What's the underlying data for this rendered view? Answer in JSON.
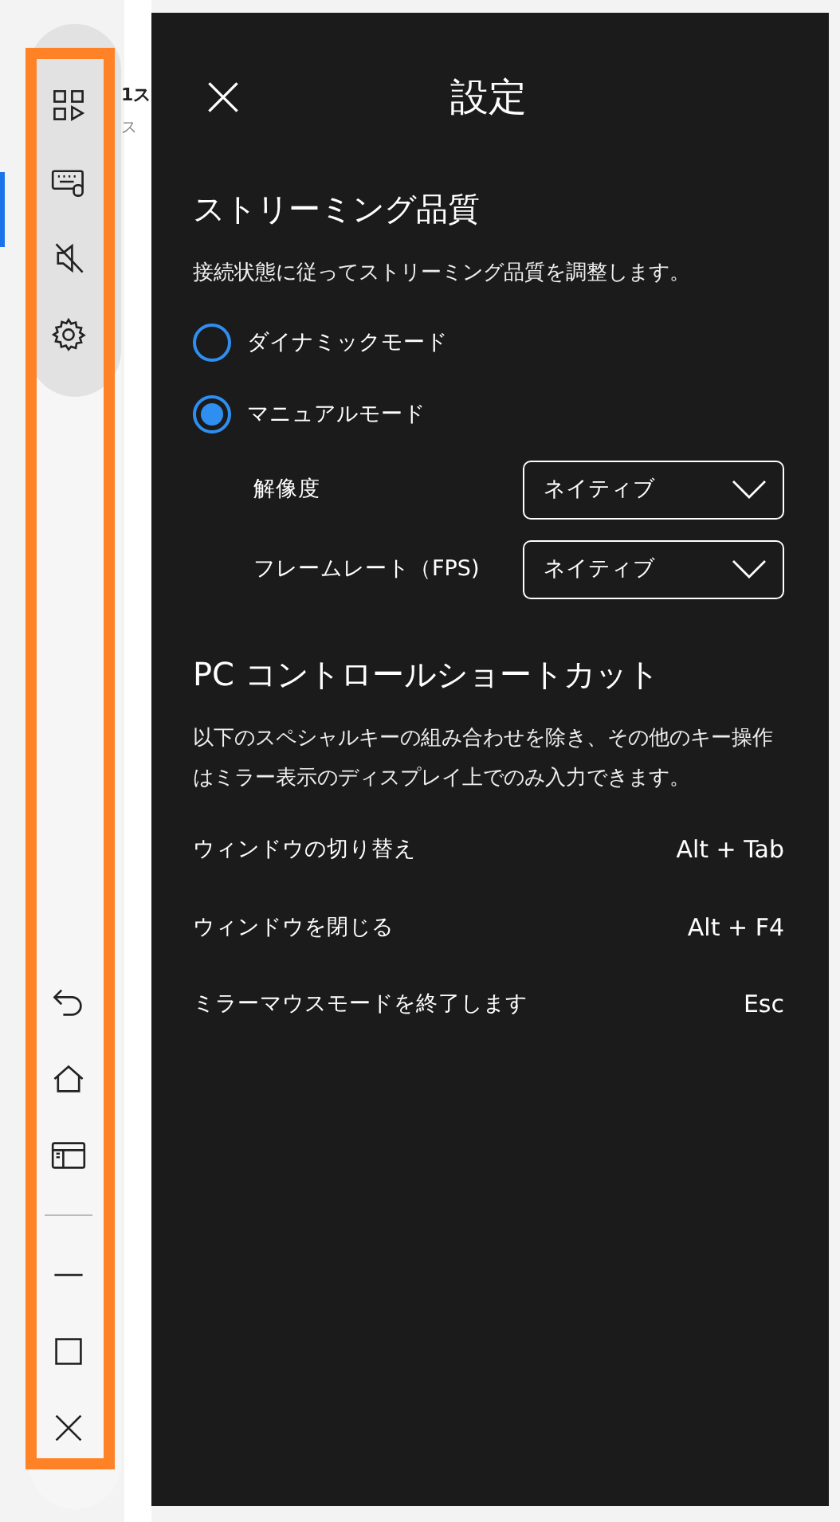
{
  "background_app": {
    "title": "1ス",
    "subtitle": "ス"
  },
  "settings_panel": {
    "title": "設定",
    "streaming_quality": {
      "heading": "ストリーミング品質",
      "description": "接続状態に従ってストリーミング品質を調整します。",
      "modes": [
        {
          "label": "ダイナミックモード",
          "selected": false
        },
        {
          "label": "マニュアルモード",
          "selected": true
        }
      ],
      "options": [
        {
          "label": "解像度",
          "value": "ネイティブ"
        },
        {
          "label": "フレームレート（FPS)",
          "value": "ネイティブ"
        }
      ]
    },
    "shortcuts": {
      "heading": "PC コントロールショートカット",
      "description": "以下のスペシャルキーの組み合わせを除き、その他のキー操作はミラー表示のディスプレイ上でのみ入力できます。",
      "items": [
        {
          "action": "ウィンドウの切り替え",
          "keys": "Alt + Tab"
        },
        {
          "action": "ウィンドウを閉じる",
          "keys": "Alt + F4"
        },
        {
          "action": "ミラーマウスモードを終了します",
          "keys": "Esc"
        }
      ]
    }
  }
}
